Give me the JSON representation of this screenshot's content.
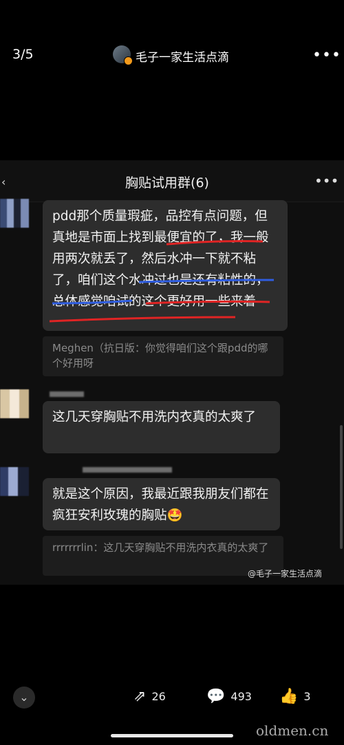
{
  "top": {
    "counter": "3/5",
    "author": "毛子一家生活点滴",
    "more": "•••"
  },
  "chat": {
    "title": "胸贴试用群(6)",
    "back": "‹",
    "more": "•••",
    "messages": [
      {
        "text": "pdd那个质量瑕疵，品控有点问题，但真地是市面上找到最便宜的了，我一般用两次就丢了，然后水冲一下就不粘了，咱们这个水冲过也是还有粘性的，总体感觉咱试的这个更好用一些来着",
        "quote": "Meghen（抗日版：你觉得咱们这个跟pdd的哪个好用呀"
      },
      {
        "text": "这几天穿胸贴不用洗内衣真的太爽了"
      },
      {
        "text": "就是这个原因，我最近跟我朋友们都在疯狂安利玫瑰的胸贴🤩",
        "quote": "rrrrrrrlin：这几天穿胸贴不用洗内衣真的太爽了"
      }
    ],
    "watermark": "@毛子一家生活点滴"
  },
  "bottom": {
    "collapse_icon": "chevron-down-icon",
    "share_count": "26",
    "comment_count": "493",
    "like_count": "3",
    "site": "oldmen.cn"
  }
}
